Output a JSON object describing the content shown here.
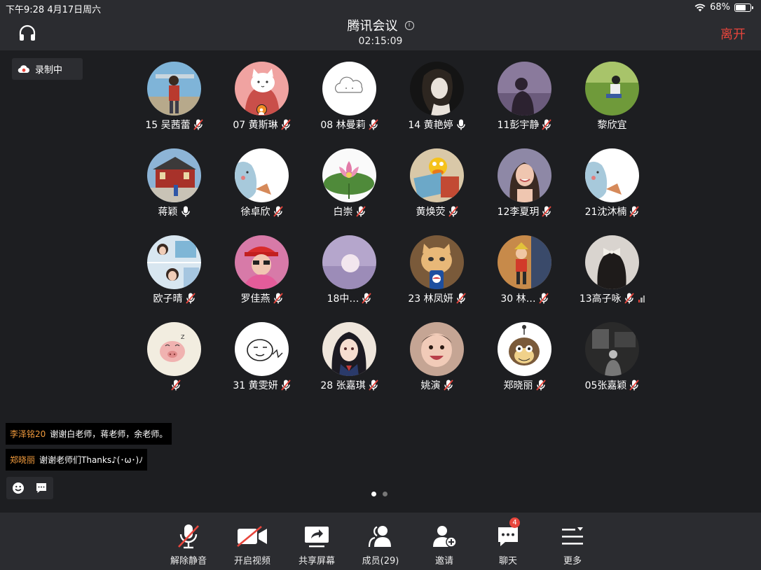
{
  "status_bar": {
    "time_date": "下午9:28  4月17日周六",
    "battery": "68%",
    "battery_level": 0.68
  },
  "header": {
    "title": "腾讯会议",
    "info_glyph": "i",
    "elapsed": "02:15:09",
    "leave_label": "离开",
    "leave_color": "#e8453c"
  },
  "recording": {
    "label": "录制中"
  },
  "participants": [
    {
      "name": "15 吴茜蕾",
      "mic": "muted",
      "avatar": "photo-person-outdoor"
    },
    {
      "name": "07 黄斯琳",
      "mic": "muted",
      "avatar": "cartoon-cat",
      "host": true
    },
    {
      "name": "08 林曼莉",
      "mic": "muted",
      "avatar": "cloud-sketch"
    },
    {
      "name": "14 黄艳婷",
      "mic": "on",
      "avatar": "anime-girl-dark"
    },
    {
      "name": "11彭宇静",
      "mic": "muted",
      "avatar": "photo-silhouette-purple"
    },
    {
      "name": "黎欣宜",
      "mic": "none",
      "avatar": "photo-child-grass"
    },
    {
      "name": "蒋颖",
      "mic": "on",
      "avatar": "photo-temple"
    },
    {
      "name": "徐卓欣",
      "mic": "muted",
      "avatar": "cartoon-blue-animal"
    },
    {
      "name": "白崇",
      "mic": "muted",
      "avatar": "lotus-flower"
    },
    {
      "name": "黄焕荧",
      "mic": "muted",
      "avatar": "elmo-reading"
    },
    {
      "name": "12李夏玥",
      "mic": "muted",
      "avatar": "photo-smiling-girl"
    },
    {
      "name": "21沈沐楠",
      "mic": "muted",
      "avatar": "cartoon-blue-animal"
    },
    {
      "name": "欧子晴",
      "mic": "muted",
      "avatar": "photo-collage-girls"
    },
    {
      "name": "罗佳燕",
      "mic": "muted",
      "avatar": "photo-red-hat"
    },
    {
      "name": "18中…",
      "mic": "muted",
      "avatar": "moon-purple-sky"
    },
    {
      "name": "23 林凤妍",
      "mic": "muted",
      "avatar": "cat-pepsi"
    },
    {
      "name": "30  林…",
      "mic": "muted",
      "avatar": "pinocchio"
    },
    {
      "name": "13高子咏",
      "mic": "muted",
      "avatar": "girl-hair-bow",
      "signal": true
    },
    {
      "name": "",
      "mic": "muted",
      "avatar": "cartoon-pig"
    },
    {
      "name": "31 黄雯妍",
      "mic": "muted",
      "avatar": "cartoon-sketch-face"
    },
    {
      "name": "28 张嘉琪",
      "mic": "muted",
      "avatar": "anime-schoolgirl"
    },
    {
      "name": "姚演",
      "mic": "muted",
      "avatar": "photo-baby"
    },
    {
      "name": "郑晓丽",
      "mic": "muted",
      "avatar": "cartoon-monkey"
    },
    {
      "name": "05张嘉颖",
      "mic": "muted",
      "avatar": "photo-dark-room"
    }
  ],
  "chat_messages": [
    {
      "sender": "李泽铭20",
      "text": "谢谢白老师，蒋老师，余老师。"
    },
    {
      "sender": "郑晓丽",
      "text": "谢谢老师们Thanks♪(･ω･)ﾉ"
    }
  ],
  "chat_controls": [
    "emoji-icon",
    "message-icon"
  ],
  "pagination": {
    "pages": 2,
    "current": 1
  },
  "toolbar": [
    {
      "label": "解除静音",
      "icon": "mic-muted-icon"
    },
    {
      "label": "开启视频",
      "icon": "camera-off-icon"
    },
    {
      "label": "共享屏幕",
      "icon": "share-screen-icon"
    },
    {
      "label": "成员(29)",
      "icon": "members-icon"
    },
    {
      "label": "邀请",
      "icon": "invite-icon"
    },
    {
      "label": "聊天",
      "icon": "chat-icon",
      "badge": "4"
    },
    {
      "label": "更多",
      "icon": "more-icon"
    }
  ]
}
